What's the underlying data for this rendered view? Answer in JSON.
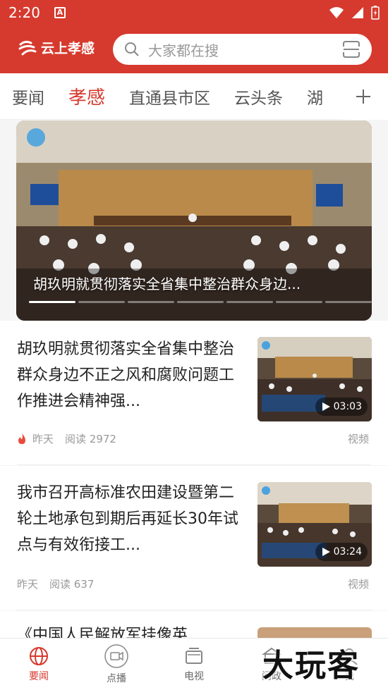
{
  "status": {
    "time": "2:20",
    "notif": "A"
  },
  "header": {
    "logo_text": "云上孝感",
    "search_placeholder": "大家都在搜"
  },
  "tabs": [
    "要闻",
    "孝感",
    "直通县市区",
    "云头条",
    "湖"
  ],
  "banner": {
    "caption": "胡玖明就贯彻落实全省集中整治群众身边..."
  },
  "articles": [
    {
      "title": "胡玖明就贯彻落实全省集中整治群众身边不正之风和腐败问题工作推进会精神强...",
      "hot": true,
      "date": "昨天",
      "reads": "阅读 2972",
      "duration": "03:03",
      "tag": "视频"
    },
    {
      "title": "我市召开高标准农田建设暨第二轮土地承包到期后再延长30年试点与有效衔接工...",
      "hot": false,
      "date": "昨天",
      "reads": "阅读 637",
      "duration": "03:24",
      "tag": "视频"
    },
    {
      "title": "《中国人民解放军挂像英"
    }
  ],
  "nav": [
    "要闻",
    "点播",
    "电视",
    "问政",
    "我"
  ],
  "watermark": "大玩客",
  "colors": {
    "brand": "#d63a2e"
  }
}
